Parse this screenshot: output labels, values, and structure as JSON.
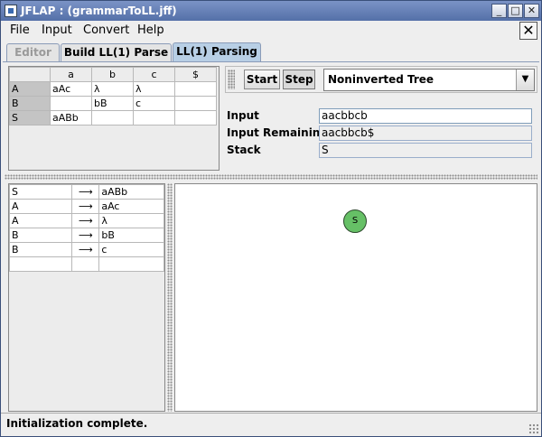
{
  "window": {
    "title": "JFLAP : (grammarToLL.jff)"
  },
  "menu": [
    "File",
    "Input",
    "Convert",
    "Help"
  ],
  "tabs": [
    "Editor",
    "Build LL(1) Parse",
    "LL(1) Parsing"
  ],
  "parse_table": {
    "headers": [
      "",
      "a",
      "b",
      "c",
      "$"
    ],
    "rows": [
      [
        "A",
        "aAc",
        "λ",
        "λ",
        ""
      ],
      [
        "B",
        "",
        "bB",
        "c",
        ""
      ],
      [
        "S",
        "aABb",
        "",
        "",
        ""
      ]
    ]
  },
  "controls": {
    "start_label": "Start",
    "step_label": "Step",
    "view_mode": "Noninverted Tree"
  },
  "fields": {
    "input_label": "Input",
    "input_value": "aacbbcb",
    "remaining_label": "Input Remaining",
    "remaining_value": "aacbbcb$",
    "stack_label": "Stack",
    "stack_value": "S"
  },
  "productions": [
    {
      "lhs": "S",
      "arrow": "⟶",
      "rhs": "aABb"
    },
    {
      "lhs": "A",
      "arrow": "⟶",
      "rhs": "aAc"
    },
    {
      "lhs": "A",
      "arrow": "⟶",
      "rhs": "λ"
    },
    {
      "lhs": "B",
      "arrow": "⟶",
      "rhs": "bB"
    },
    {
      "lhs": "B",
      "arrow": "⟶",
      "rhs": "c"
    },
    {
      "lhs": "",
      "arrow": "",
      "rhs": ""
    }
  ],
  "tree": {
    "root_label": "S",
    "node_color": "#66c066"
  },
  "status": "Initialization complete."
}
